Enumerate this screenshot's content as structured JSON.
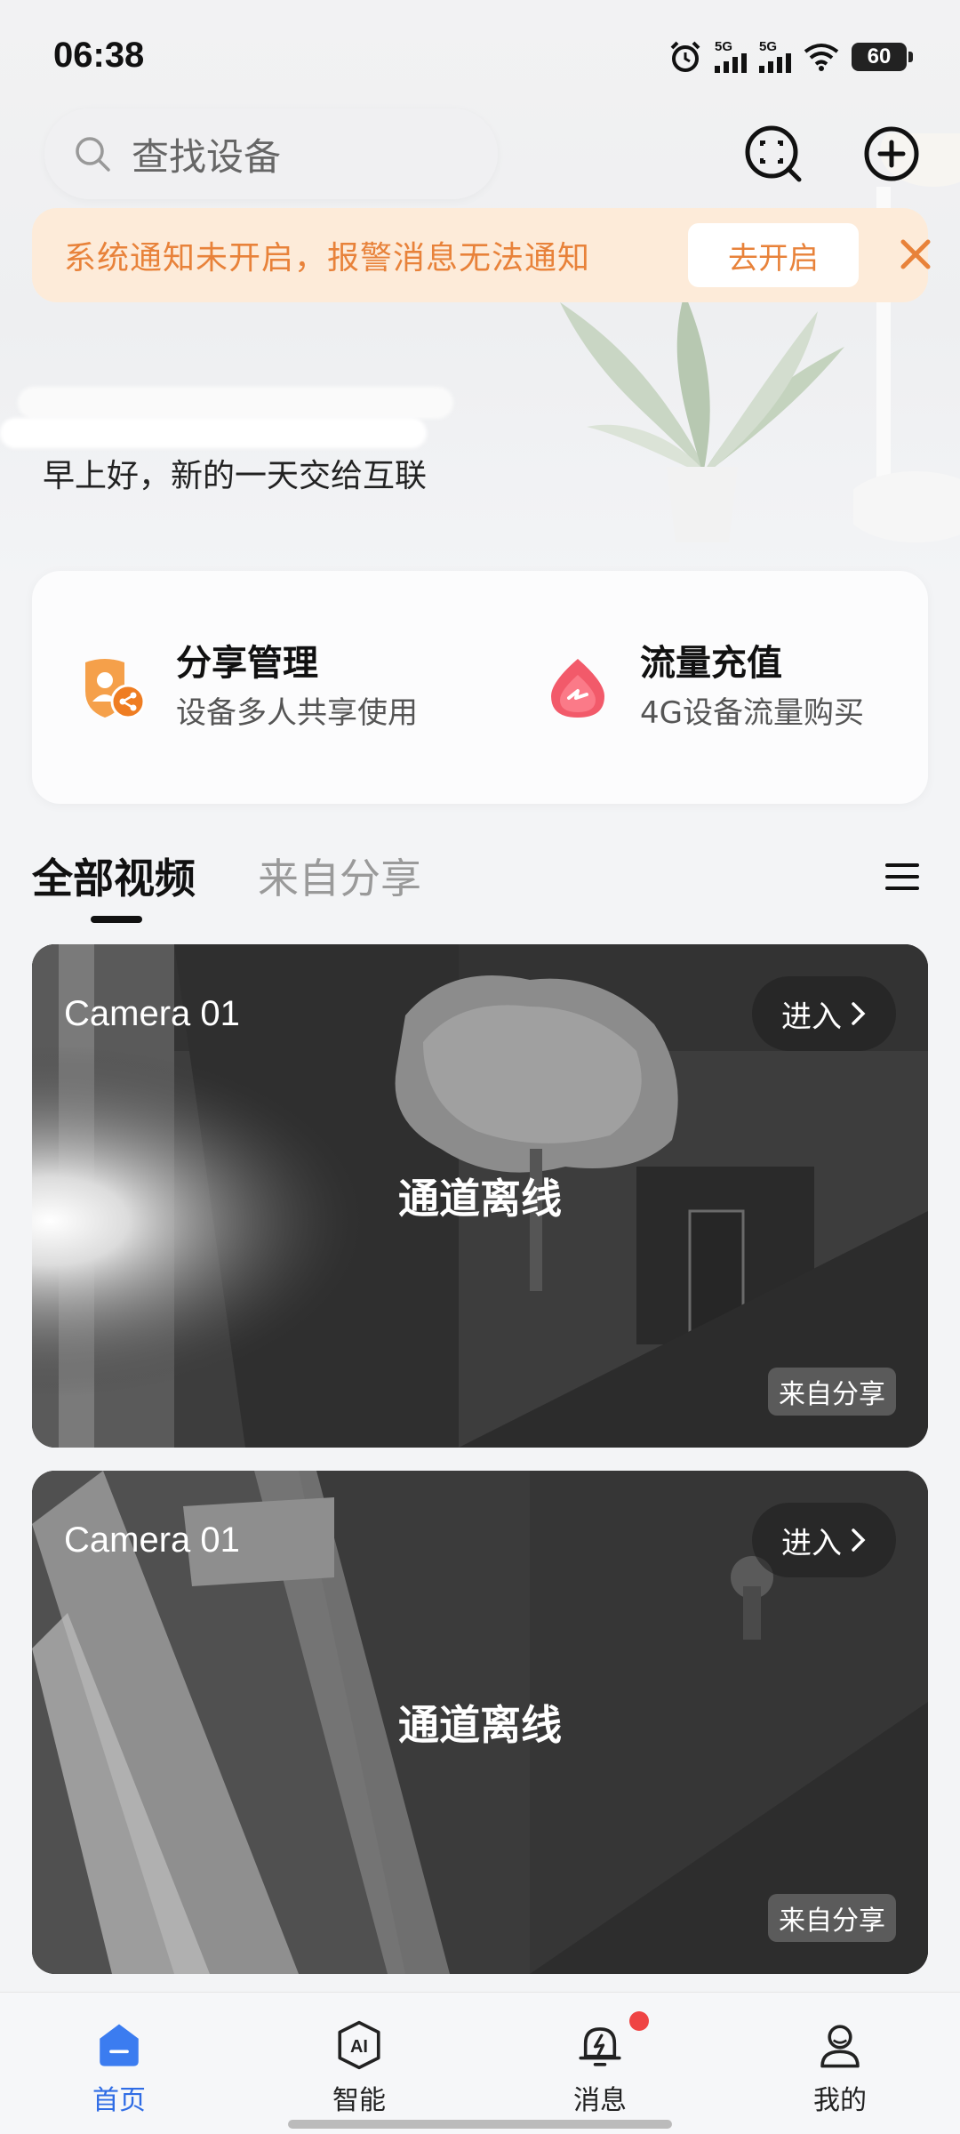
{
  "status_bar": {
    "time": "06:38",
    "signal1_label": "5G",
    "signal2_label": "5G",
    "battery": "60"
  },
  "search": {
    "placeholder": "查找设备"
  },
  "notice": {
    "text": "系统通知未开启，报警消息无法通知",
    "button": "去开启"
  },
  "greeting": {
    "subtitle": "早上好，新的一天交给互联"
  },
  "quick_actions": [
    {
      "title": "分享管理",
      "subtitle": "设备多人共享使用",
      "icon": "share-shield-icon",
      "color": "#f08a2e"
    },
    {
      "title": "流量充值",
      "subtitle": "4G设备流量购买",
      "icon": "traffic-drop-icon",
      "color": "#f0455a"
    }
  ],
  "tabs": [
    {
      "label": "全部视频",
      "active": true
    },
    {
      "label": "来自分享",
      "active": false
    }
  ],
  "cameras": [
    {
      "name": "Camera 01",
      "enter": "进入",
      "status": "通道离线",
      "tag": "来自分享"
    },
    {
      "name": "Camera 01",
      "enter": "进入",
      "status": "通道离线",
      "tag": "来自分享"
    }
  ],
  "nav": [
    {
      "label": "首页",
      "icon": "home-icon",
      "active": true
    },
    {
      "label": "智能",
      "icon": "ai-shield-icon",
      "active": false
    },
    {
      "label": "消息",
      "icon": "alarm-bell-icon",
      "active": false,
      "badge": true
    },
    {
      "label": "我的",
      "icon": "profile-icon",
      "active": false
    }
  ],
  "colors": {
    "accent": "#2f6ce5",
    "warning": "#e8823a",
    "warning_bg": "#fdebd9",
    "badge": "#ef4444"
  }
}
